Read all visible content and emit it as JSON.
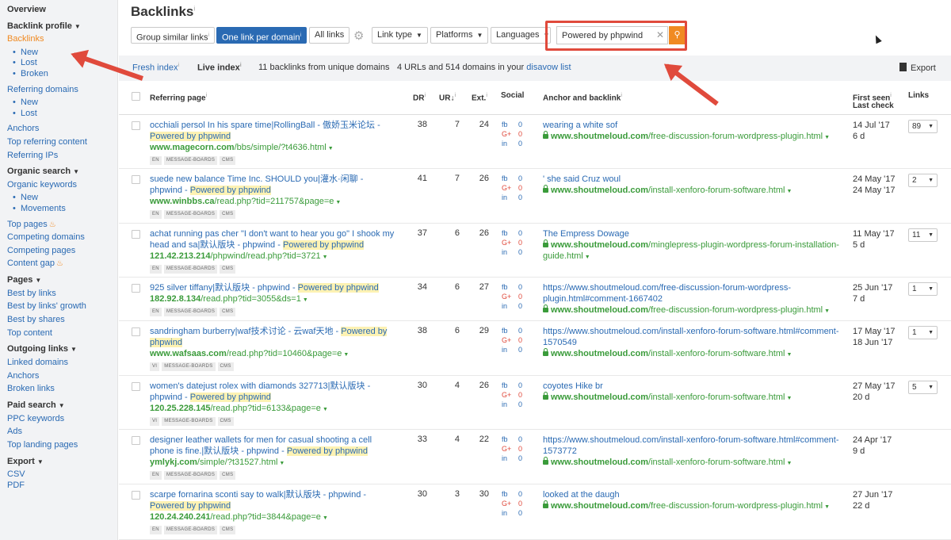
{
  "sidebar": {
    "overview": "Overview",
    "backlink_profile": "Backlink profile",
    "backlinks": "Backlinks",
    "bl_new": "New",
    "bl_lost": "Lost",
    "bl_broken": "Broken",
    "referring_domains": "Referring domains",
    "rd_new": "New",
    "rd_lost": "Lost",
    "anchors": "Anchors",
    "top_referring_content": "Top referring content",
    "referring_ips": "Referring IPs",
    "organic_search": "Organic search",
    "organic_keywords": "Organic keywords",
    "ok_new": "New",
    "ok_movements": "Movements",
    "top_pages": "Top pages",
    "competing_domains": "Competing domains",
    "competing_pages": "Competing pages",
    "content_gap": "Content gap",
    "pages": "Pages",
    "best_by_links": "Best by links",
    "best_by_links_growth": "Best by links' growth",
    "best_by_shares": "Best by shares",
    "top_content": "Top content",
    "outgoing_links": "Outgoing links",
    "linked_domains": "Linked domains",
    "out_anchors": "Anchors",
    "broken_links": "Broken links",
    "paid_search": "Paid search",
    "ppc_keywords": "PPC keywords",
    "ads": "Ads",
    "top_landing_pages": "Top landing pages",
    "export": "Export",
    "csv": "CSV",
    "pdf": "PDF"
  },
  "header": {
    "title": "Backlinks",
    "title_info": "i"
  },
  "toolbar": {
    "group_similar": "Group similar links",
    "one_per_domain": "One link per domain",
    "all_links": "All links",
    "info": "i",
    "link_type": "Link type",
    "platforms": "Platforms",
    "languages": "Languages",
    "search_value": "Powered by phpwind"
  },
  "indexbar": {
    "fresh": "Fresh index",
    "live": "Live index",
    "count": "11 backlinks from unique domains",
    "disavow_prefix": "4 URLs and 514 domains in your",
    "disavow_link": "disavow list",
    "export": "Export"
  },
  "columns": {
    "referring_page": "Referring page",
    "dr": "DR",
    "ur": "UR",
    "ext": "Ext.",
    "social": "Social",
    "anchor": "Anchor and backlink",
    "first_seen": "First seen",
    "last_check": "Last check",
    "links": "Links"
  },
  "social_labels": {
    "fb": "fb",
    "gp": "G+",
    "in": "in"
  },
  "rows": [
    {
      "title_pre": "occhiali persol In his spare time|RollingBall - 傲娇玉米论坛 - ",
      "title_hl": "Powered by phpwind",
      "title_post": "",
      "domain": "www.magecorn.com",
      "path": "/bbs/simple/?t4636.html",
      "tags": [
        "EN",
        "MESSAGE-BOARDS",
        "CMS"
      ],
      "dr": "38",
      "ur": "7",
      "ext": "24",
      "fb": "0",
      "gp": "0",
      "in": "0",
      "anchor_text": "wearing a white sof",
      "backlink_domain": "www.shoutmeloud.com",
      "backlink_path": "/free-discussion-forum-wordpress-plugin.html",
      "first_seen": "14 Jul '17",
      "last_check": "6 d",
      "links": "89"
    },
    {
      "title_pre": "suede new balance Time Inc. SHOULD you|灌水·闲聊 - phpwind - ",
      "title_hl": "Powered by phpwind",
      "title_post": "",
      "domain": "www.winbbs.ca",
      "path": "/read.php?tid=211757&page=e",
      "tags": [
        "EN",
        "MESSAGE-BOARDS",
        "CMS"
      ],
      "dr": "41",
      "ur": "7",
      "ext": "26",
      "fb": "0",
      "gp": "0",
      "in": "0",
      "anchor_text": "' she said Cruz woul",
      "backlink_domain": "www.shoutmeloud.com",
      "backlink_path": "/install-xenforo-forum-software.html",
      "first_seen": "24 May '17",
      "last_check": "24 May '17",
      "links": "2"
    },
    {
      "title_pre": "achat running pas cher \"I don't want to hear you go\" I shook my head and sa|默认版块 - phpwind - ",
      "title_hl": "Powered by phpwind",
      "title_post": "",
      "domain": "121.42.213.214",
      "path": "/phpwind/read.php?tid=3721",
      "tags": [
        "EN",
        "MESSAGE-BOARDS",
        "CMS"
      ],
      "dr": "37",
      "ur": "6",
      "ext": "26",
      "fb": "0",
      "gp": "0",
      "in": "0",
      "anchor_text": "The Empress Dowage",
      "backlink_domain": "www.shoutmeloud.com",
      "backlink_path": "/minglepress-plugin-wordpress-forum-installation-guide.html",
      "first_seen": "11 May '17",
      "last_check": "5 d",
      "links": "11"
    },
    {
      "title_pre": "925 silver tiffany|默认版块 - phpwind - ",
      "title_hl": "Powered by phpwind",
      "title_post": "",
      "domain": "182.92.8.134",
      "path": "/read.php?tid=3055&ds=1",
      "tags": [
        "EN",
        "MESSAGE-BOARDS",
        "CMS"
      ],
      "dr": "34",
      "ur": "6",
      "ext": "27",
      "fb": "0",
      "gp": "0",
      "in": "0",
      "anchor_text": "https://www.shoutmeloud.com/free-discussion-forum-wordpress-plugin.html#comment-1667402",
      "backlink_domain": "www.shoutmeloud.com",
      "backlink_path": "/free-discussion-forum-wordpress-plugin.html",
      "first_seen": "25 Jun '17",
      "last_check": "7 d",
      "links": "1"
    },
    {
      "title_pre": "sandringham burberry|waf技术讨论 - 云waf天地 - ",
      "title_hl": "Powered by phpwind",
      "title_post": "",
      "domain": "www.wafsaas.com",
      "path": "/read.php?tid=10460&page=e",
      "tags": [
        "VI",
        "MESSAGE-BOARDS",
        "CMS"
      ],
      "dr": "38",
      "ur": "6",
      "ext": "29",
      "fb": "0",
      "gp": "0",
      "in": "0",
      "anchor_text": "https://www.shoutmeloud.com/install-xenforo-forum-software.html#comment-1570549",
      "backlink_domain": "www.shoutmeloud.com",
      "backlink_path": "/install-xenforo-forum-software.html",
      "first_seen": "17 May '17",
      "last_check": "18 Jun '17",
      "links": "1"
    },
    {
      "title_pre": "women's datejust rolex with diamonds 327713|默认版块 - phpwind - ",
      "title_hl": "Powered by phpwind",
      "title_post": "",
      "domain": "120.25.228.145",
      "path": "/read.php?tid=6133&page=e",
      "tags": [
        "VI",
        "MESSAGE-BOARDS",
        "CMS"
      ],
      "dr": "30",
      "ur": "4",
      "ext": "26",
      "fb": "0",
      "gp": "0",
      "in": "0",
      "anchor_text": "coyotes Hike br",
      "backlink_domain": "www.shoutmeloud.com",
      "backlink_path": "/install-xenforo-forum-software.html",
      "first_seen": "27 May '17",
      "last_check": "20 d",
      "links": "5"
    },
    {
      "title_pre": "designer leather wallets for men for casual shooting a cell phone is fine.|默认版块 - phpwind - ",
      "title_hl": "Powered by phpwind",
      "title_post": "",
      "domain": "ymlykj.com",
      "path": "/simple/?t31527.html",
      "tags": [
        "EN",
        "MESSAGE-BOARDS",
        "CMS"
      ],
      "dr": "33",
      "ur": "4",
      "ext": "22",
      "fb": "0",
      "gp": "0",
      "in": "0",
      "anchor_text": "https://www.shoutmeloud.com/install-xenforo-forum-software.html#comment-1573772",
      "backlink_domain": "www.shoutmeloud.com",
      "backlink_path": "/install-xenforo-forum-software.html",
      "first_seen": "24 Apr '17",
      "last_check": "9 d",
      "links": ""
    },
    {
      "title_pre": "scarpe fornarina sconti say to walk|默认版块 - phpwind - ",
      "title_hl": "Powered by phpwind",
      "title_post": "",
      "domain": "120.24.240.241",
      "path": "/read.php?tid=3844&page=e",
      "tags": [
        "EN",
        "MESSAGE-BOARDS",
        "CMS"
      ],
      "dr": "30",
      "ur": "3",
      "ext": "30",
      "fb": "0",
      "gp": "0",
      "in": "0",
      "anchor_text": "looked at the daugh",
      "backlink_domain": "www.shoutmeloud.com",
      "backlink_path": "/free-discussion-forum-wordpress-plugin.html",
      "first_seen": "27 Jun '17",
      "last_check": "22 d",
      "links": ""
    }
  ],
  "colors": {
    "link": "#2a6ab3",
    "url_green": "#3a9b3a",
    "accent_orange": "#f08a22",
    "highlight": "#fdf2b3",
    "annotation_red": "#e04a3c",
    "selected_button": "#2a6ab3"
  },
  "icons": [
    "gear-icon",
    "close-icon",
    "search-icon",
    "export-icon",
    "fire-icon",
    "lock-icon",
    "chevron-down-icon",
    "sort-down-icon"
  ]
}
